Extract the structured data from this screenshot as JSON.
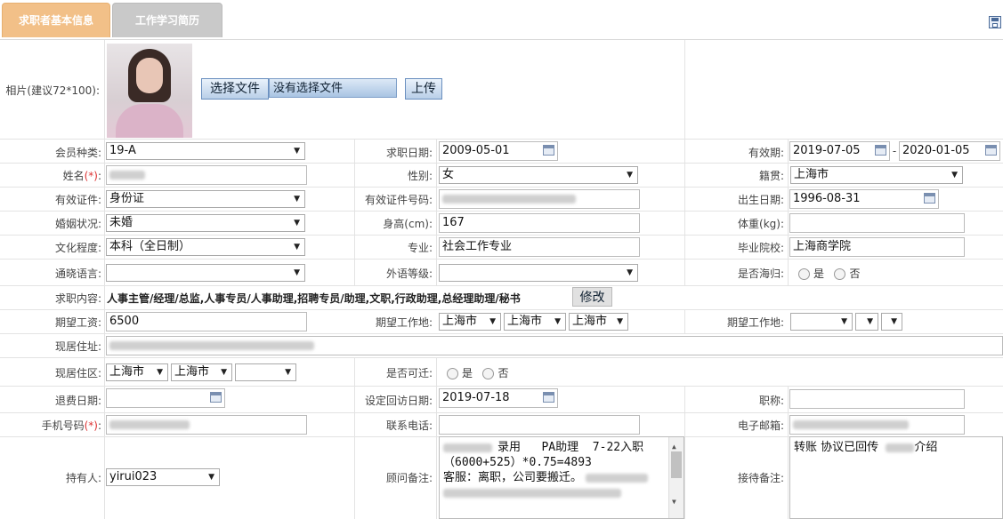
{
  "tabs": {
    "basic": "求职者基本信息",
    "work": "工作学习简历"
  },
  "photo": {
    "label": "相片(建议72*100):",
    "choose_button": "选择文件",
    "file_status": "没有选择文件",
    "upload_button": "上传"
  },
  "fields": {
    "member_type": {
      "label": "会员种类:",
      "value": "19-A"
    },
    "job_date": {
      "label": "求职日期:",
      "value": "2009-05-01"
    },
    "valid_period": {
      "label": "有效期:",
      "from": "2019-07-05",
      "sep": "-",
      "to": "2020-01-05"
    },
    "name": {
      "label": "姓名",
      "req": "(*)",
      "colon": ":"
    },
    "gender": {
      "label": "性别:",
      "value": "女"
    },
    "native_place": {
      "label": "籍贯:",
      "value": "上海市"
    },
    "id_type": {
      "label": "有效证件:",
      "value": "身份证"
    },
    "id_number": {
      "label": "有效证件号码:"
    },
    "birth_date": {
      "label": "出生日期:",
      "value": "1996-08-31"
    },
    "marital": {
      "label": "婚姻状况:",
      "value": "未婚"
    },
    "height": {
      "label": "身高(cm):",
      "value": "167"
    },
    "weight": {
      "label": "体重(kg):",
      "value": ""
    },
    "education": {
      "label": "文化程度:",
      "value": "本科（全日制）"
    },
    "major": {
      "label": "专业:",
      "value": "社会工作专业"
    },
    "school": {
      "label": "毕业院校:",
      "value": "上海商学院"
    },
    "language": {
      "label": "通晓语言:",
      "value": ""
    },
    "foreign_level": {
      "label": "外语等级:",
      "value": ""
    },
    "returnee": {
      "label": "是否海归:",
      "yes": "是",
      "no": "否"
    },
    "job_content": {
      "label": "求职内容:",
      "value": "人事主管/经理/总监,人事专员/人事助理,招聘专员/助理,文职,行政助理,总经理助理/秘书",
      "edit_button": "修改"
    },
    "salary": {
      "label": "期望工资:",
      "value": "6500"
    },
    "work_place1": {
      "label": "期望工作地:",
      "values": [
        "上海市",
        "上海市",
        "上海市"
      ]
    },
    "work_place2": {
      "label": "期望工作地:",
      "values": [
        "",
        "",
        ""
      ]
    },
    "address": {
      "label": "现居住址:"
    },
    "district": {
      "label": "现居住区:",
      "values": [
        "上海市",
        "上海市",
        ""
      ]
    },
    "relocate": {
      "label": "是否可迁:",
      "yes": "是",
      "no": "否"
    },
    "refund_date": {
      "label": "退费日期:",
      "value": ""
    },
    "callback_date": {
      "label": "设定回访日期:",
      "value": "2019-07-18"
    },
    "title": {
      "label": "职称:",
      "value": ""
    },
    "mobile": {
      "label": "手机号码",
      "req": "(*)",
      "colon": ":"
    },
    "phone": {
      "label": "联系电话:",
      "value": ""
    },
    "email": {
      "label": "电子邮箱:"
    },
    "holder": {
      "label": "持有人:",
      "value": "yirui023"
    },
    "consultant_note": {
      "label": "顾问备注:",
      "lines": [
        "录用   PA助理  7-22入职",
        "（6000+525）*0.75=4893",
        "客服：离职，公司要搬迁。"
      ]
    },
    "reception_note": {
      "label": "接待备注:",
      "text_a": "转账 协议已回传",
      "text_b": "介绍"
    }
  },
  "icons": {
    "save": "save-icon",
    "calendar": "calendar-icon",
    "dropdown": "dropdown-arrow-icon"
  }
}
